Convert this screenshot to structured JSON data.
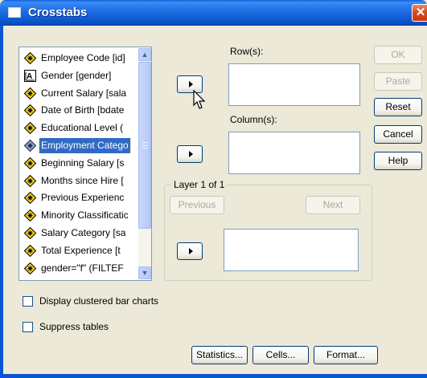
{
  "window": {
    "title": "Crosstabs",
    "close_glyph": "✕"
  },
  "variables": [
    {
      "label": "Employee Code [id]",
      "icon": "scale-icon",
      "selected": false
    },
    {
      "label": "Gender [gender]",
      "icon": "nominal-string-icon",
      "selected": false
    },
    {
      "label": "Current Salary [sala",
      "icon": "scale-icon",
      "selected": false
    },
    {
      "label": "Date of Birth [bdate",
      "icon": "scale-icon",
      "selected": false
    },
    {
      "label": "Educational Level (",
      "icon": "scale-icon",
      "selected": false
    },
    {
      "label": "Employment Catego",
      "icon": "scale-icon",
      "selected": true
    },
    {
      "label": "Beginning Salary [s",
      "icon": "scale-icon",
      "selected": false
    },
    {
      "label": "Months since Hire [",
      "icon": "scale-icon",
      "selected": false
    },
    {
      "label": "Previous Experienc",
      "icon": "scale-icon",
      "selected": false
    },
    {
      "label": "Minority Classificatic",
      "icon": "scale-icon",
      "selected": false
    },
    {
      "label": "Salary Category [sa",
      "icon": "scale-icon",
      "selected": false
    },
    {
      "label": "Total Experience [t",
      "icon": "scale-icon",
      "selected": false
    },
    {
      "label": "gender=\"f\" (FILTEF",
      "icon": "scale-icon",
      "selected": false
    }
  ],
  "rows": {
    "label": "Row(s):"
  },
  "columns": {
    "label": "Column(s):"
  },
  "layer": {
    "label": "Layer 1 of 1",
    "previous_label": "Previous",
    "next_label": "Next"
  },
  "side_buttons": {
    "ok": "OK",
    "paste": "Paste",
    "reset": "Reset",
    "cancel": "Cancel",
    "help": "Help"
  },
  "options": {
    "clustered_bar_label": "Display clustered bar charts",
    "clustered_bar_checked": false,
    "suppress_tables_label": "Suppress tables",
    "suppress_tables_checked": false
  },
  "bottom_buttons": {
    "statistics": "Statistics...",
    "cells": "Cells...",
    "format": "Format..."
  },
  "colors": {
    "titlebar": "#0b53c9",
    "selection": "#316ac5",
    "dialog_bg": "#ece9d8"
  }
}
